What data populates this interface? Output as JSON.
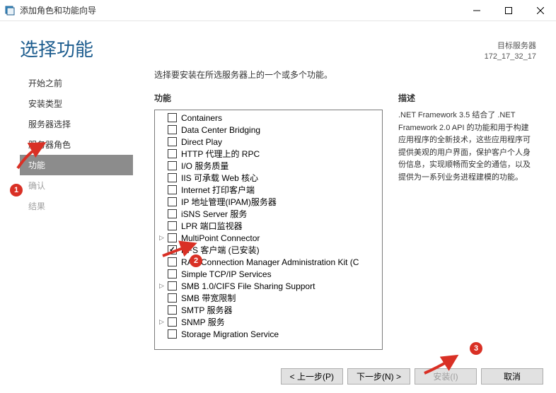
{
  "titlebar": {
    "title": "添加角色和功能向导"
  },
  "header": {
    "page_title": "选择功能",
    "target_label": "目标服务器",
    "target_value": "172_17_32_17"
  },
  "sidebar": {
    "items": [
      {
        "label": "开始之前",
        "selected": false,
        "muted": false
      },
      {
        "label": "安装类型",
        "selected": false,
        "muted": false
      },
      {
        "label": "服务器选择",
        "selected": false,
        "muted": false
      },
      {
        "label": "服务器角色",
        "selected": false,
        "muted": false
      },
      {
        "label": "功能",
        "selected": true,
        "muted": false
      },
      {
        "label": "确认",
        "selected": false,
        "muted": true
      },
      {
        "label": "结果",
        "selected": false,
        "muted": true
      }
    ]
  },
  "content": {
    "instruction": "选择要安装在所选服务器上的一个或多个功能。",
    "features_heading": "功能",
    "description_heading": "描述",
    "description_text": ".NET Framework 3.5 结合了 .NET Framework 2.0 API 的功能和用于构建应用程序的全新技术，这些应用程序可提供美观的用户界面，保护客户个人身份信息，实现顺畅而安全的通信，以及提供为一系列业务进程建模的功能。",
    "features": [
      {
        "label": "Containers",
        "checked": false,
        "expandable": false,
        "indent": 0
      },
      {
        "label": "Data Center Bridging",
        "checked": false,
        "expandable": false,
        "indent": 0
      },
      {
        "label": "Direct Play",
        "checked": false,
        "expandable": false,
        "indent": 0
      },
      {
        "label": "HTTP 代理上的 RPC",
        "checked": false,
        "expandable": false,
        "indent": 0
      },
      {
        "label": "I/O 服务质量",
        "checked": false,
        "expandable": false,
        "indent": 0
      },
      {
        "label": "IIS 可承载 Web 核心",
        "checked": false,
        "expandable": false,
        "indent": 0
      },
      {
        "label": "Internet 打印客户端",
        "checked": false,
        "expandable": false,
        "indent": 0
      },
      {
        "label": "IP 地址管理(IPAM)服务器",
        "checked": false,
        "expandable": false,
        "indent": 0
      },
      {
        "label": "iSNS Server 服务",
        "checked": false,
        "expandable": false,
        "indent": 0
      },
      {
        "label": "LPR 端口监视器",
        "checked": false,
        "expandable": false,
        "indent": 0
      },
      {
        "label": "MultiPoint Connector",
        "checked": false,
        "expandable": true,
        "indent": 0
      },
      {
        "label": "NFS 客户端 (已安装)",
        "checked": true,
        "expandable": false,
        "indent": 0
      },
      {
        "label": "RAS Connection Manager Administration Kit (C",
        "checked": false,
        "expandable": false,
        "indent": 0
      },
      {
        "label": "Simple TCP/IP Services",
        "checked": false,
        "expandable": false,
        "indent": 0
      },
      {
        "label": "SMB 1.0/CIFS File Sharing Support",
        "checked": false,
        "expandable": true,
        "indent": 0
      },
      {
        "label": "SMB 带宽限制",
        "checked": false,
        "expandable": false,
        "indent": 0
      },
      {
        "label": "SMTP 服务器",
        "checked": false,
        "expandable": false,
        "indent": 0
      },
      {
        "label": "SNMP 服务",
        "checked": false,
        "expandable": true,
        "indent": 0
      },
      {
        "label": "Storage Migration Service",
        "checked": false,
        "expandable": false,
        "indent": 0
      }
    ]
  },
  "buttons": {
    "previous": "< 上一步(P)",
    "next": "下一步(N) >",
    "install": "安装(I)",
    "cancel": "取消"
  },
  "annotations": {
    "badge1": "1",
    "badge2": "2",
    "badge3": "3"
  }
}
